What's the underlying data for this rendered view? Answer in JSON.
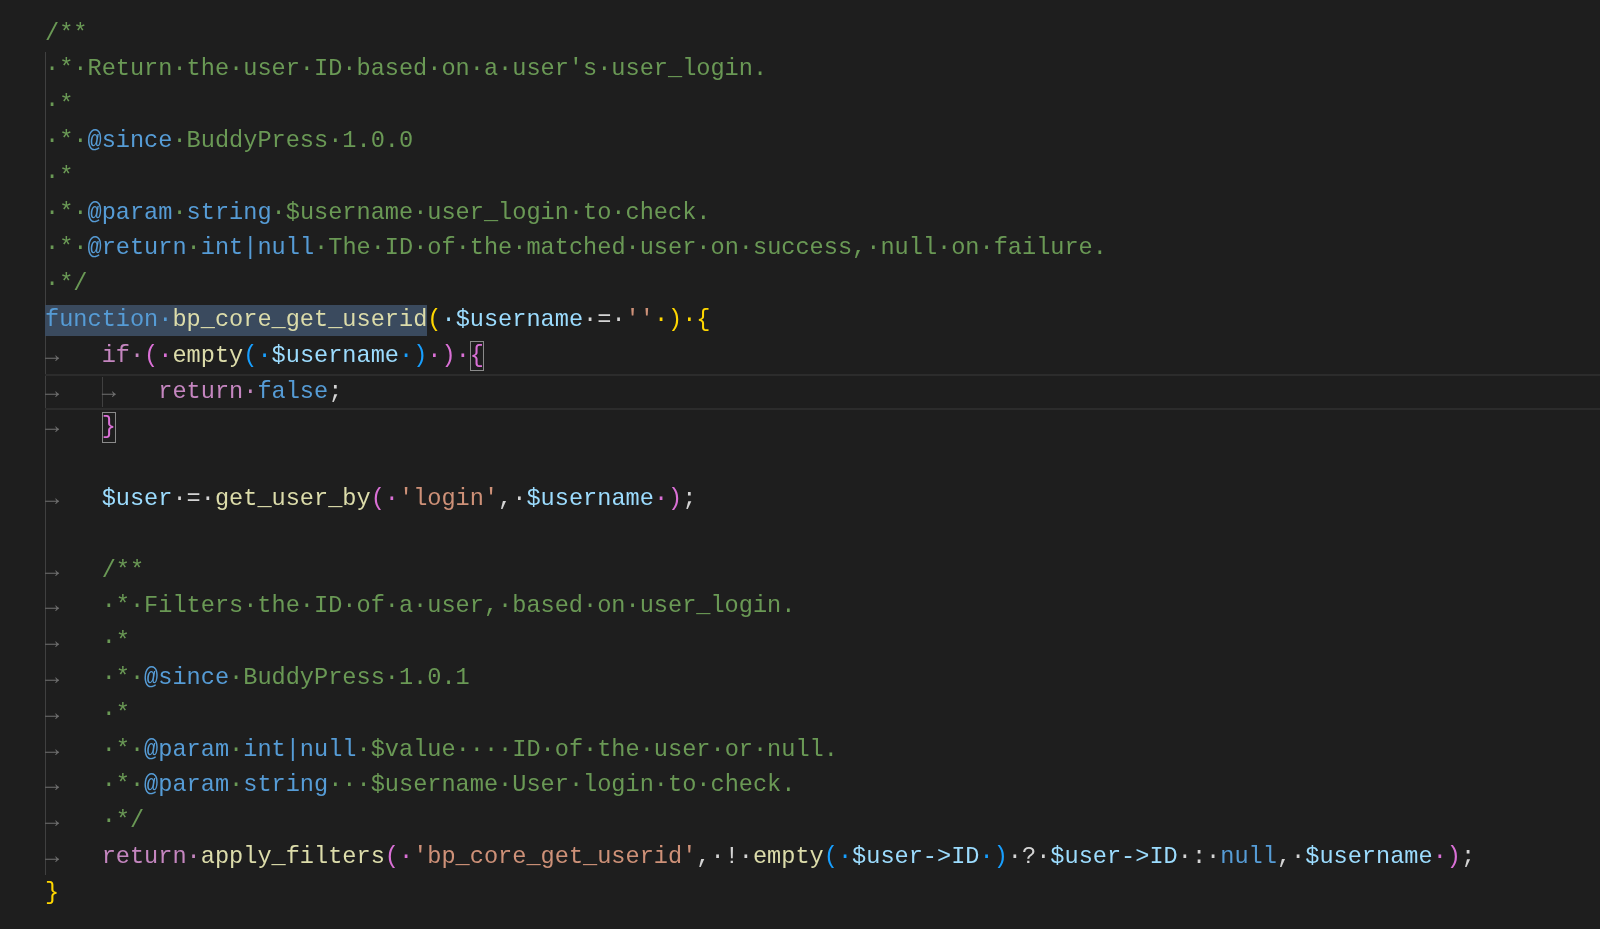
{
  "editor": {
    "lines": [
      {
        "current": false,
        "tokens": [
          {
            "kind": "comment",
            "t": "/**"
          }
        ]
      },
      {
        "current": false,
        "tokens": [
          {
            "kind": "comment",
            "t": "·*·Return·the·user·ID·based·on·a·user's·user_login."
          }
        ]
      },
      {
        "current": false,
        "tokens": [
          {
            "kind": "comment",
            "t": "·*"
          }
        ]
      },
      {
        "current": false,
        "tokens": [
          {
            "kind": "comment",
            "t": "·*·"
          },
          {
            "kind": "tag",
            "t": "@since"
          },
          {
            "kind": "comment",
            "t": "·BuddyPress·1.0.0"
          }
        ]
      },
      {
        "current": false,
        "tokens": [
          {
            "kind": "comment",
            "t": "·*"
          }
        ]
      },
      {
        "current": false,
        "tokens": [
          {
            "kind": "comment",
            "t": "·*·"
          },
          {
            "kind": "tag",
            "t": "@param"
          },
          {
            "kind": "comment",
            "t": "·"
          },
          {
            "kind": "type",
            "t": "string"
          },
          {
            "kind": "comment",
            "t": "·$username·user_login·to·check."
          }
        ]
      },
      {
        "current": false,
        "tokens": [
          {
            "kind": "comment",
            "t": "·*·"
          },
          {
            "kind": "tag",
            "t": "@return"
          },
          {
            "kind": "comment",
            "t": "·"
          },
          {
            "kind": "type",
            "t": "int|null"
          },
          {
            "kind": "comment",
            "t": "·The·ID·of·the·matched·user·on·success,·null·on·failure."
          }
        ]
      },
      {
        "current": false,
        "tokens": [
          {
            "kind": "comment",
            "t": "·*/"
          }
        ]
      },
      {
        "current": false,
        "selection": [
          {
            "kind": "keyword",
            "t": "function·"
          },
          {
            "kind": "function",
            "t": "bp_core_get_userid"
          }
        ],
        "tokens": [
          {
            "kind": "bracket-gold",
            "t": "("
          },
          {
            "kind": "variable",
            "t": "·$username"
          },
          {
            "kind": "punct",
            "t": "·=·"
          },
          {
            "kind": "string",
            "t": "''"
          },
          {
            "kind": "bracket-gold",
            "t": "·)·{"
          }
        ]
      },
      {
        "current": false,
        "tokens": [
          {
            "kind": "tab",
            "t": "→"
          },
          {
            "kind": "control",
            "t": "if·"
          },
          {
            "kind": "bracket-orchid",
            "t": "(·"
          },
          {
            "kind": "function",
            "t": "empty"
          },
          {
            "kind": "bracket-blue",
            "t": "(·"
          },
          {
            "kind": "variable",
            "t": "$username"
          },
          {
            "kind": "bracket-blue",
            "t": "·)"
          },
          {
            "kind": "bracket-orchid",
            "t": "·)·"
          },
          {
            "kind": "bracket-orchid-matched",
            "t": "{"
          }
        ]
      },
      {
        "current": true,
        "tokens": [
          {
            "kind": "tab",
            "t": "→"
          },
          {
            "kind": "tab",
            "t": "→"
          },
          {
            "kind": "control",
            "t": "return·"
          },
          {
            "kind": "constant",
            "t": "false"
          },
          {
            "kind": "punct",
            "t": ";"
          }
        ]
      },
      {
        "current": false,
        "tokens": [
          {
            "kind": "tab",
            "t": "→"
          },
          {
            "kind": "bracket-orchid-matched",
            "t": "}"
          }
        ]
      },
      {
        "current": false
      },
      {
        "current": false,
        "tokens": [
          {
            "kind": "tab",
            "t": "→"
          },
          {
            "kind": "variable",
            "t": "$user"
          },
          {
            "kind": "punct",
            "t": "·=·"
          },
          {
            "kind": "function",
            "t": "get_user_by"
          },
          {
            "kind": "bracket-orchid",
            "t": "(·"
          },
          {
            "kind": "string",
            "t": "'login'"
          },
          {
            "kind": "punct",
            "t": ",·"
          },
          {
            "kind": "variable",
            "t": "$username"
          },
          {
            "kind": "bracket-orchid",
            "t": "·)"
          },
          {
            "kind": "punct",
            "t": ";"
          }
        ]
      },
      {
        "current": false
      },
      {
        "current": false,
        "tokens": [
          {
            "kind": "tab",
            "t": "→"
          },
          {
            "kind": "comment",
            "t": "/**"
          }
        ]
      },
      {
        "current": false,
        "tokens": [
          {
            "kind": "tab",
            "t": "→"
          },
          {
            "kind": "comment",
            "t": "·*·Filters·the·ID·of·a·user,·based·on·user_login."
          }
        ]
      },
      {
        "current": false,
        "tokens": [
          {
            "kind": "tab",
            "t": "→"
          },
          {
            "kind": "comment",
            "t": "·*"
          }
        ]
      },
      {
        "current": false,
        "tokens": [
          {
            "kind": "tab",
            "t": "→"
          },
          {
            "kind": "comment",
            "t": "·*·"
          },
          {
            "kind": "tag",
            "t": "@since"
          },
          {
            "kind": "comment",
            "t": "·BuddyPress·1.0.1"
          }
        ]
      },
      {
        "current": false,
        "tokens": [
          {
            "kind": "tab",
            "t": "→"
          },
          {
            "kind": "comment",
            "t": "·*"
          }
        ]
      },
      {
        "current": false,
        "tokens": [
          {
            "kind": "tab",
            "t": "→"
          },
          {
            "kind": "comment",
            "t": "·*·"
          },
          {
            "kind": "tag",
            "t": "@param"
          },
          {
            "kind": "comment",
            "t": "·"
          },
          {
            "kind": "type",
            "t": "int|null"
          },
          {
            "kind": "comment",
            "t": "·$value····ID·of·the·user·or·null."
          }
        ]
      },
      {
        "current": false,
        "tokens": [
          {
            "kind": "tab",
            "t": "→"
          },
          {
            "kind": "comment",
            "t": "·*·"
          },
          {
            "kind": "tag",
            "t": "@param"
          },
          {
            "kind": "comment",
            "t": "·"
          },
          {
            "kind": "type",
            "t": "string"
          },
          {
            "kind": "comment",
            "t": "···$username·User·login·to·check."
          }
        ]
      },
      {
        "current": false,
        "tokens": [
          {
            "kind": "tab",
            "t": "→"
          },
          {
            "kind": "comment",
            "t": "·*/"
          }
        ]
      },
      {
        "current": false,
        "tokens": [
          {
            "kind": "tab",
            "t": "→"
          },
          {
            "kind": "control",
            "t": "return·"
          },
          {
            "kind": "function",
            "t": "apply_filters"
          },
          {
            "kind": "bracket-orchid",
            "t": "(·"
          },
          {
            "kind": "string",
            "t": "'bp_core_get_userid'"
          },
          {
            "kind": "punct",
            "t": ",·!·"
          },
          {
            "kind": "function",
            "t": "empty"
          },
          {
            "kind": "bracket-blue",
            "t": "(·"
          },
          {
            "kind": "variable",
            "t": "$user->ID"
          },
          {
            "kind": "bracket-blue",
            "t": "·)"
          },
          {
            "kind": "punct",
            "t": "·?·"
          },
          {
            "kind": "variable",
            "t": "$user->ID"
          },
          {
            "kind": "punct",
            "t": "·:·"
          },
          {
            "kind": "constant",
            "t": "null"
          },
          {
            "kind": "punct",
            "t": ",·"
          },
          {
            "kind": "variable",
            "t": "$username"
          },
          {
            "kind": "bracket-orchid",
            "t": "·)"
          },
          {
            "kind": "punct",
            "t": ";"
          }
        ]
      },
      {
        "current": false,
        "tokens": [
          {
            "kind": "bracket-gold",
            "t": "}"
          }
        ]
      }
    ]
  }
}
